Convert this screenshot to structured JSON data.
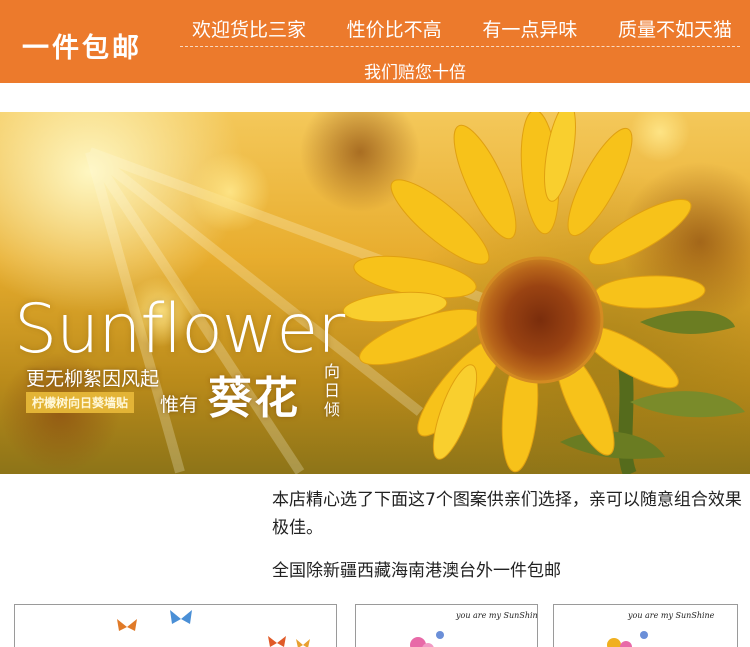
{
  "header": {
    "brand": "一件包邮",
    "slogans": [
      "欢迎货比三家",
      "性价比不高",
      "有一点异味",
      "质量不如天猫"
    ],
    "slogan_line2": "我们赔您十倍",
    "bg_color": "#ec7a2c"
  },
  "hero": {
    "title": "Sunflower",
    "line1": "更无柳絮因风起",
    "tag": "柠檬树向日葵墙贴",
    "weiyou": "惟有",
    "kuihua": "葵花",
    "vertical": "向日倾"
  },
  "content": {
    "description": "本店精心选了下面这7个图案供亲们选择，亲可以随意组合效果极佳。",
    "shipping": "全国除新疆西藏海南港澳台外一件包邮"
  },
  "thumbnails": [
    {
      "caption": ""
    },
    {
      "caption": "you are my SunShine"
    },
    {
      "caption": "you are my SunShine"
    }
  ]
}
